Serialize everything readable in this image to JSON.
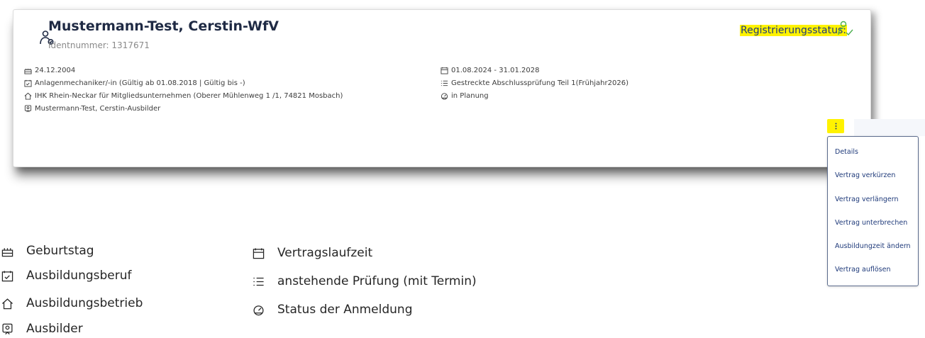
{
  "card": {
    "name": "Mustermann-Test, Cerstin-WfV",
    "ident": "Identnummer: 1317671",
    "registration_label": "Registrierungsstatus:",
    "left_rows": [
      {
        "icon": "cake-icon",
        "text": "24.12.2004"
      },
      {
        "icon": "calendar-check-icon",
        "text": "Anlagenmechaniker/-in (Gültig ab 01.08.2018 | Gültig bis -)"
      },
      {
        "icon": "home-icon",
        "text": "IHK Rhein-Neckar für Mitgliedsunternehmen (Oberer Mühlenweg 1 /1, 74821 Mosbach)"
      },
      {
        "icon": "badge-icon",
        "text": "Mustermann-Test, Cerstin-Ausbilder"
      }
    ],
    "right_rows": [
      {
        "icon": "calendar-icon",
        "text": "01.08.2024 - 31.01.2028"
      },
      {
        "icon": "list-icon",
        "text": "Gestreckte Abschlussprüfung Teil 1(Frühjahr2026)"
      },
      {
        "icon": "gauge-icon",
        "text": "in Planung"
      }
    ]
  },
  "menu": {
    "items": [
      "Details",
      "Vertrag verkürzen",
      "Vertrag verlängern",
      "Vertrag unterbrechen",
      "Ausbildungzeit ändern",
      "Vertrag auflösen"
    ]
  },
  "legend": {
    "left": [
      {
        "icon": "cake-icon",
        "text": "Geburtstag"
      },
      {
        "icon": "calendar-check-icon",
        "text": "Ausbildungsberuf"
      },
      {
        "icon": "home-icon",
        "text": "Ausbildungsbetrieb"
      },
      {
        "icon": "badge-icon",
        "text": "Ausbilder"
      }
    ],
    "right": [
      {
        "icon": "calendar-icon",
        "text": "Vertragslaufzeit"
      },
      {
        "icon": "list-icon",
        "text": "anstehende Prüfung (mit Termin)"
      },
      {
        "icon": "gauge-icon",
        "text": "Status der Anmeldung"
      }
    ]
  },
  "colors": {
    "highlight": "#fff200",
    "navy": "#1f3a7a",
    "success_green": "#4caf50"
  }
}
